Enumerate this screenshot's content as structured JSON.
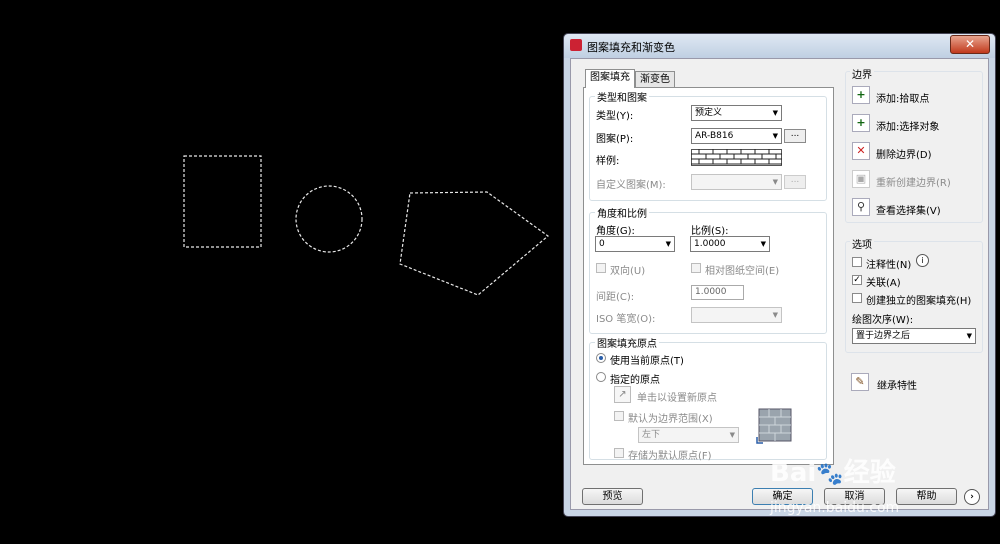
{
  "dialog": {
    "title": "图案填充和渐变色",
    "close": "✕",
    "tabs": [
      "图案填充",
      "渐变色"
    ],
    "type_group": {
      "title": "类型和图案",
      "type_label": "类型(Y):",
      "type_value": "预定义",
      "pattern_label": "图案(P):",
      "pattern_value": "AR-B816",
      "swatch_label": "样例:",
      "custom_label": "自定义图案(M):",
      "browse": "..."
    },
    "angle_group": {
      "title": "角度和比例",
      "angle_label": "角度(G):",
      "angle_value": "0",
      "scale_label": "比例(S):",
      "scale_value": "1.0000",
      "double_label": "双向(U)",
      "paper_label": "相对图纸空间(E)",
      "spacing_label": "间距(C):",
      "spacing_value": "1.0000",
      "iso_label": "ISO 笔宽(O):"
    },
    "origin_group": {
      "title": "图案填充原点",
      "use_current": "使用当前原点(T)",
      "specified": "指定的原点",
      "click_set": "单击以设置新原点",
      "default_extent": "默认为边界范围(X)",
      "extent_value": "左下",
      "store_default": "存储为默认原点(F)"
    },
    "boundaries": {
      "title": "边界",
      "add_pick": "添加:拾取点",
      "add_select": "添加:选择对象",
      "remove": "删除边界(D)",
      "recreate": "重新创建边界(R)",
      "view": "查看选择集(V)"
    },
    "options": {
      "title": "选项",
      "annotative": "注释性(N)",
      "associative": "关联(A)",
      "separate": "创建独立的图案填充(H)",
      "draw_order_label": "绘图次序(W):",
      "draw_order_value": "置于边界之后"
    },
    "inherit": "继承特性",
    "buttons": {
      "preview": "预览",
      "ok": "确定",
      "cancel": "取消",
      "help": "帮助"
    }
  },
  "watermark": {
    "line1": "Bai",
    "line2": "经验",
    "url": "jingyan.baidu.com"
  }
}
